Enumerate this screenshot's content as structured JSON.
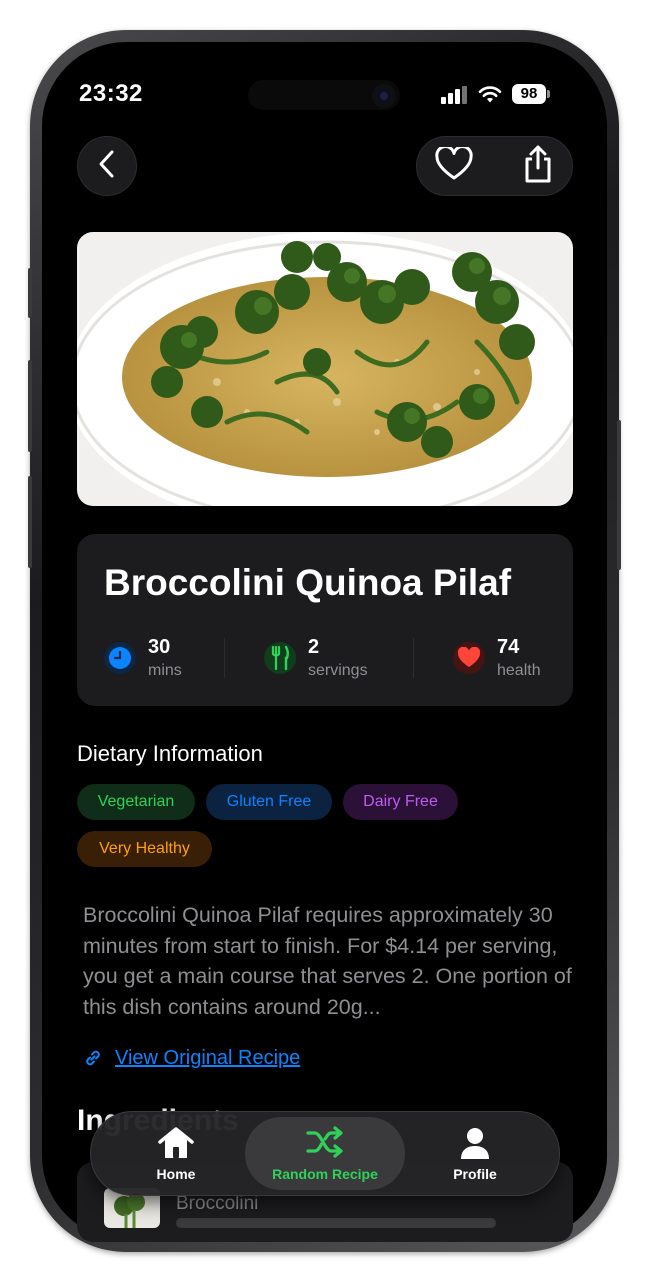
{
  "status_bar": {
    "time": "23:32",
    "battery": "98"
  },
  "nav": {
    "back_icon": "chevron-left-icon",
    "favorite_icon": "heart-outline-icon",
    "share_icon": "share-icon"
  },
  "recipe": {
    "title": "Broccolini Quinoa Pilaf",
    "stats": [
      {
        "value": "30",
        "label": "mins",
        "icon": "clock-icon",
        "color": "#0a84ff"
      },
      {
        "value": "2",
        "label": "servings",
        "icon": "fork-knife-icon",
        "color": "#30d158"
      },
      {
        "value": "74",
        "label": "health",
        "icon": "heart-icon",
        "color": "#ff453a"
      }
    ],
    "dietary": {
      "heading": "Dietary Information",
      "tags": [
        {
          "label": "Vegetarian",
          "color": "#30d158"
        },
        {
          "label": "Gluten Free",
          "color": "#0a84ff"
        },
        {
          "label": "Dairy Free",
          "color": "#bf5af2"
        },
        {
          "label": "Very Healthy",
          "color": "#ff9f0a"
        }
      ]
    },
    "description": "Broccolini Quinoa Pilaf requires approximately 30 minutes from start to finish. For $4.14 per serving, you get a main course that serves 2. One portion of this dish contains around 20g...",
    "link_label": "View Original Recipe",
    "ingredients_heading": "Ingredients",
    "ingredients": [
      {
        "name": "Broccolini"
      }
    ]
  },
  "tabbar": {
    "tabs": [
      {
        "label": "Home",
        "icon": "house-icon",
        "active": false
      },
      {
        "label": "Random Recipe",
        "icon": "shuffle-icon",
        "active": true
      },
      {
        "label": "Profile",
        "icon": "person-icon",
        "active": false
      }
    ]
  }
}
